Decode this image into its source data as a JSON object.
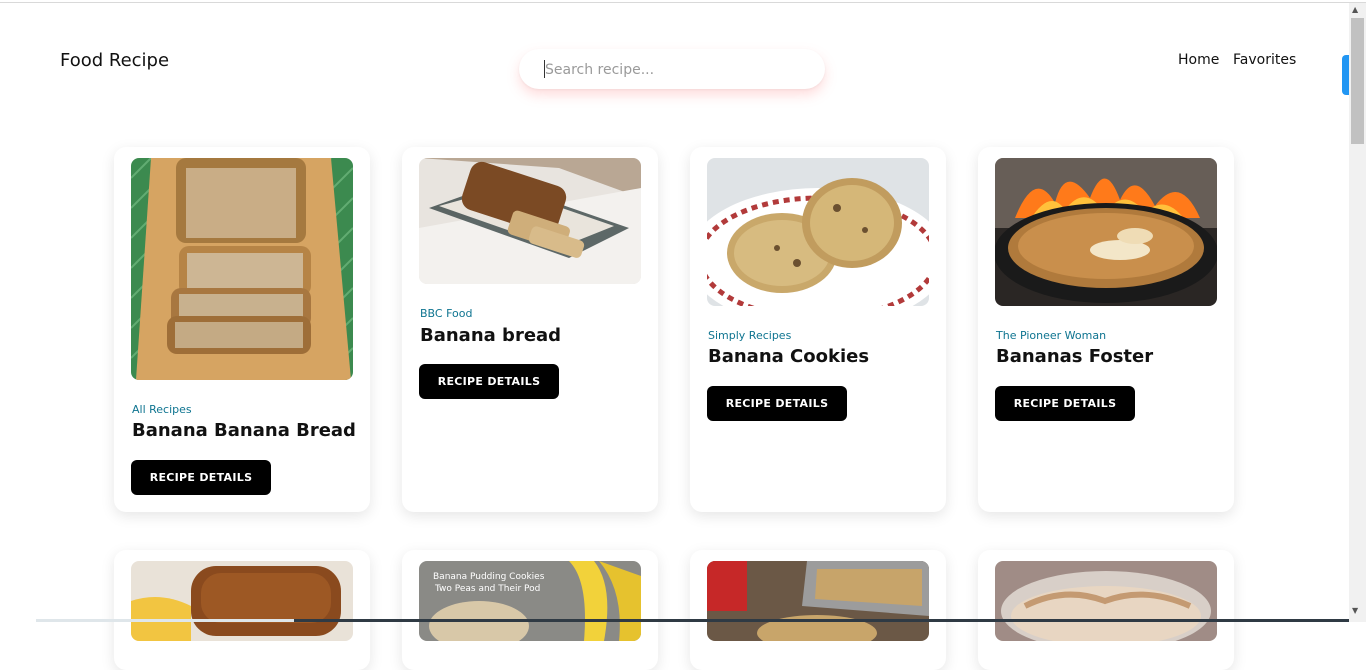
{
  "header": {
    "brand": "Food Recipe",
    "search_placeholder": "Search recipe...",
    "nav": [
      "Home",
      "Favorites"
    ]
  },
  "recipes": [
    {
      "source": "All Recipes",
      "title": "Banana Banana Bread",
      "button": "RECIPE DETAILS"
    },
    {
      "source": "BBC Food",
      "title": "Banana bread",
      "button": "RECIPE DETAILS"
    },
    {
      "source": "Simply Recipes",
      "title": "Banana Cookies",
      "button": "RECIPE DETAILS"
    },
    {
      "source": "The Pioneer Woman",
      "title": "Bananas Foster",
      "button": "RECIPE DETAILS"
    }
  ],
  "row2_images": [
    {
      "overlay_text": ""
    },
    {
      "overlay_text": "Banana Pudding Cookies\nTwo Peas and Their Pod"
    },
    {
      "overlay_text": ""
    },
    {
      "overlay_text": ""
    }
  ],
  "colors": {
    "source_text": "#0e7490",
    "button_bg": "#000000",
    "scroll_tab": "#2196f3"
  }
}
